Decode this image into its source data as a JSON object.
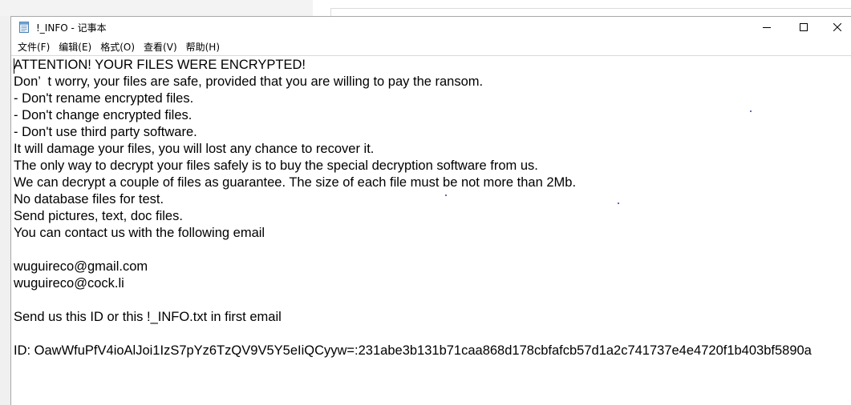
{
  "window": {
    "title": "!_INFO - 记事本",
    "icon": "notepad-icon"
  },
  "menu": [
    {
      "label": "文件(F)"
    },
    {
      "label": "编辑(E)"
    },
    {
      "label": "格式(O)"
    },
    {
      "label": "查看(V)"
    },
    {
      "label": "帮助(H)"
    }
  ],
  "document": {
    "lines": [
      "ATTENTION! YOUR FILES WERE ENCRYPTED!",
      "Don’  t worry, your files are safe, provided that you are willing to pay the ransom.",
      "- Don't rename encrypted files.",
      "- Don't change encrypted files.",
      "- Don't use third party software.",
      "It will damage your files, you will lost any chance to recover it.",
      "The only way to decrypt your files safely is to buy the special decryption software from us.",
      "We can decrypt a couple of files as guarantee. The size of each file must be not more than 2Mb.",
      "No database files for test.",
      "Send pictures, text, doc files.",
      "You can contact us with the following email",
      "",
      "wuguireco@gmail.com",
      "wuguireco@cock.li",
      "",
      "Send us this ID or this !_INFO.txt in first email",
      "",
      "ID: OawWfuPfV4ioAlJoi1IzS7pYz6TzQV9V5Y5eIiQCyyw=:231abe3b131b71caa868d178cbfafcb57d1a2c741737e4e4720f1b403bf5890a"
    ]
  }
}
